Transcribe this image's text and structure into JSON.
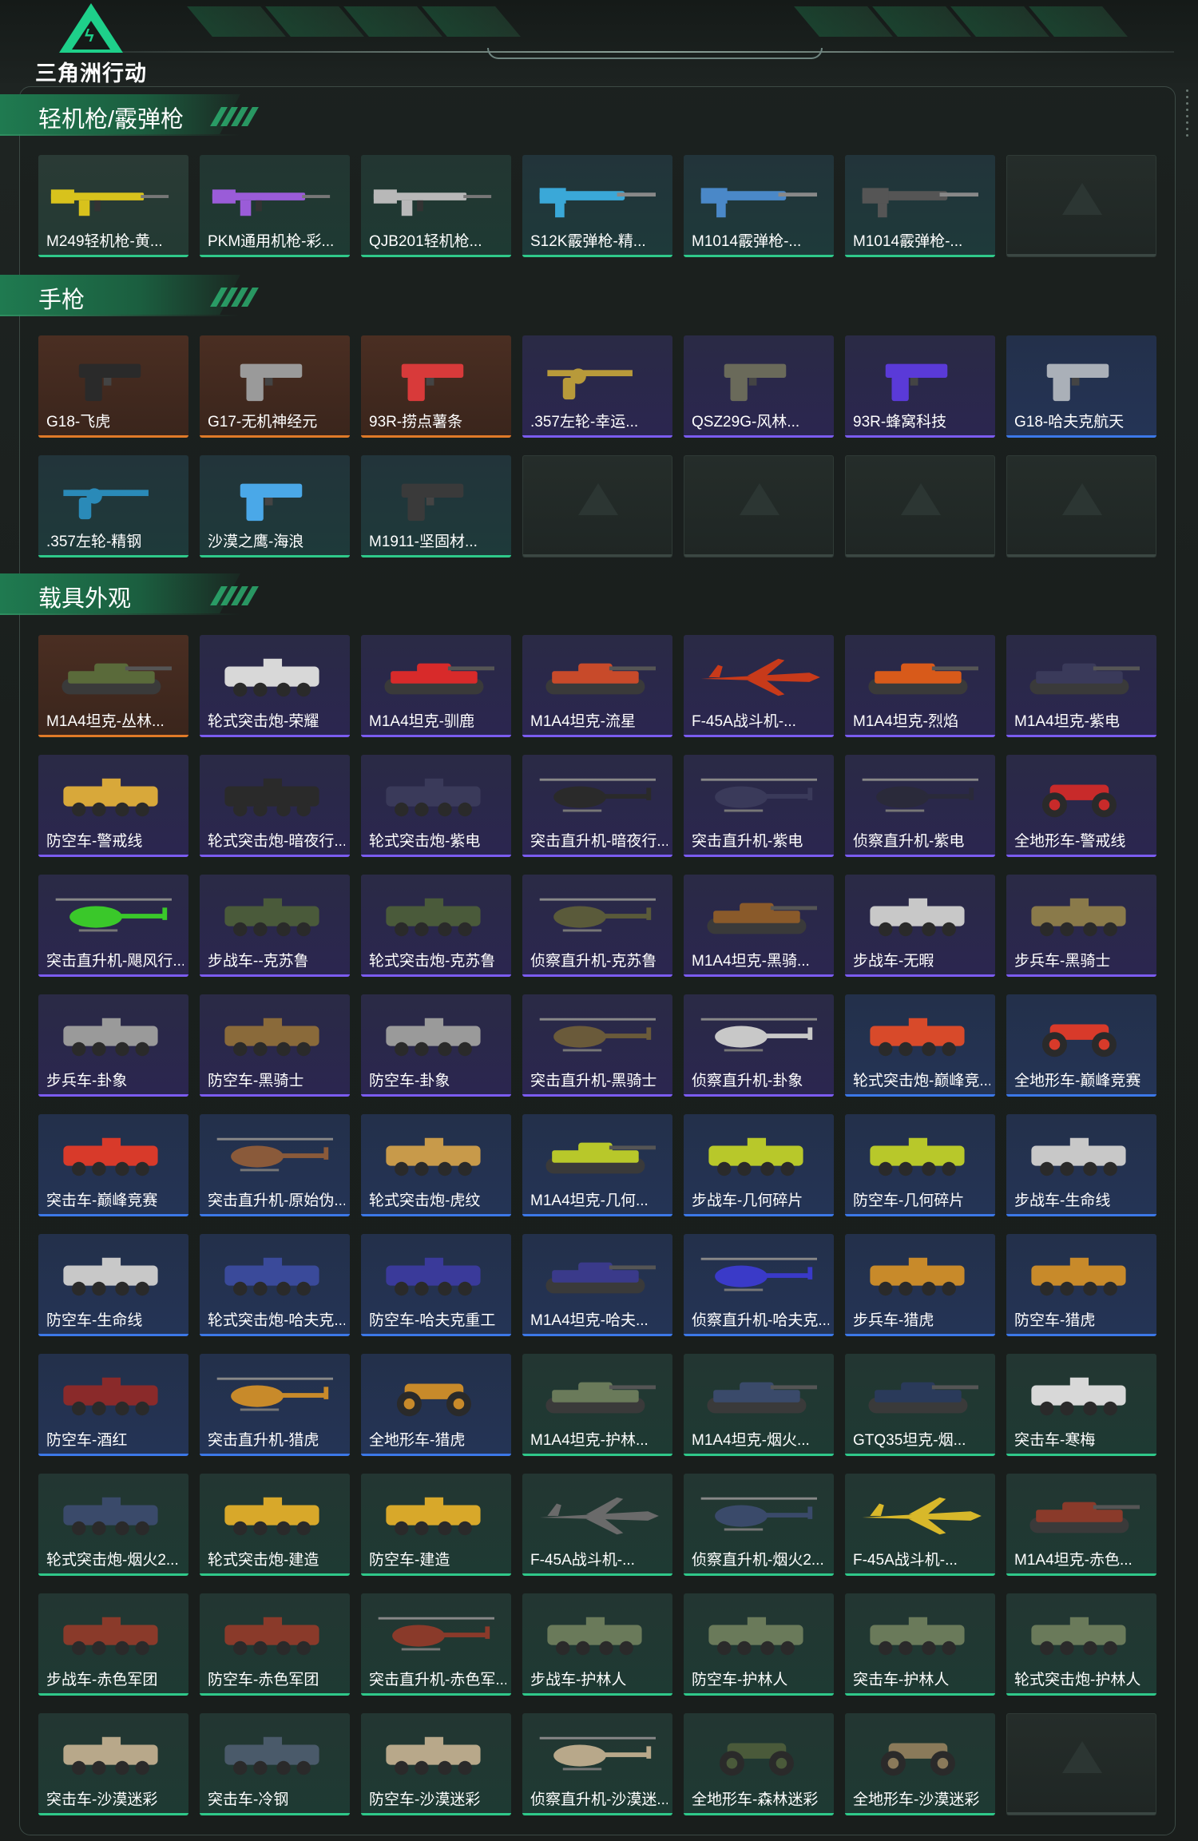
{
  "header": {
    "logo_text": "三角洲行动"
  },
  "sections": [
    {
      "title": "轻机枪/霰弹枪",
      "items": [
        {
          "name": "M249轻机枪-黄...",
          "quality": "gold",
          "icon": "lmg-icon",
          "color": "#d8c21c"
        },
        {
          "name": "PKM通用机枪-彩...",
          "quality": "green",
          "icon": "lmg-icon",
          "color": "#9a5cd8"
        },
        {
          "name": "QJB201轻机枪...",
          "quality": "green",
          "icon": "lmg-icon",
          "color": "#b8b8b8"
        },
        {
          "name": "S12K霰弹枪-精...",
          "quality": "teal",
          "icon": "shotgun-icon",
          "color": "#3aa8d8"
        },
        {
          "name": "M1014霰弹枪-...",
          "quality": "teal",
          "icon": "shotgun-icon",
          "color": "#4a88c8"
        },
        {
          "name": "M1014霰弹枪-...",
          "quality": "teal",
          "icon": "shotgun-icon",
          "color": "#555555"
        },
        {
          "name": "",
          "quality": "empty",
          "icon": "",
          "color": ""
        }
      ]
    },
    {
      "title": "手枪",
      "items": [
        {
          "name": "G18-飞虎",
          "quality": "red",
          "icon": "pistol-icon",
          "color": "#2a2a2a"
        },
        {
          "name": "G17-无机神经元",
          "quality": "red",
          "icon": "pistol-icon",
          "color": "#9a9a9a"
        },
        {
          "name": "93R-捞点薯条",
          "quality": "red",
          "icon": "pistol-icon",
          "color": "#d83a3a"
        },
        {
          "name": ".357左轮-幸运...",
          "quality": "purple",
          "icon": "revolver-icon",
          "color": "#b89a3a"
        },
        {
          "name": "QSZ29G-风林...",
          "quality": "purple",
          "icon": "pistol-icon",
          "color": "#6a6a5a"
        },
        {
          "name": "93R-蜂窝科技",
          "quality": "purple",
          "icon": "pistol-icon",
          "color": "#5a3ad8"
        },
        {
          "name": "G18-哈夫克航天",
          "quality": "blue",
          "icon": "pistol-icon",
          "color": "#aab0b8"
        },
        {
          "name": ".357左轮-精钢",
          "quality": "teal",
          "icon": "revolver-icon",
          "color": "#2a8ab8"
        },
        {
          "name": "沙漠之鹰-海浪",
          "quality": "teal",
          "icon": "pistol-icon",
          "color": "#4aa8e8"
        },
        {
          "name": "M1911-坚固材...",
          "quality": "teal",
          "icon": "pistol-icon",
          "color": "#3a3a3a"
        },
        {
          "name": "",
          "quality": "empty",
          "icon": "",
          "color": ""
        },
        {
          "name": "",
          "quality": "empty",
          "icon": "",
          "color": ""
        },
        {
          "name": "",
          "quality": "empty",
          "icon": "",
          "color": ""
        },
        {
          "name": "",
          "quality": "empty",
          "icon": "",
          "color": ""
        }
      ]
    },
    {
      "title": "载具外观",
      "items": [
        {
          "name": "M1A4坦克-丛林...",
          "quality": "red",
          "icon": "tank-icon",
          "color": "#5a6a3a"
        },
        {
          "name": "轮式突击炮-荣耀",
          "quality": "purple",
          "icon": "apc-icon",
          "color": "#d8d8d8"
        },
        {
          "name": "M1A4坦克-驯鹿",
          "quality": "purple",
          "icon": "tank-icon",
          "color": "#d82a2a"
        },
        {
          "name": "M1A4坦克-流星",
          "quality": "purple",
          "icon": "tank-icon",
          "color": "#c84a2a"
        },
        {
          "name": "F-45A战斗机-...",
          "quality": "purple",
          "icon": "jet-icon",
          "color": "#c83a1a"
        },
        {
          "name": "M1A4坦克-烈焰",
          "quality": "purple",
          "icon": "tank-icon",
          "color": "#d85a1a"
        },
        {
          "name": "M1A4坦克-紫电",
          "quality": "purple",
          "icon": "tank-icon",
          "color": "#3a3a5a"
        },
        {
          "name": "防空车-警戒线",
          "quality": "purple",
          "icon": "apc-icon",
          "color": "#d8a83a"
        },
        {
          "name": "轮式突击炮-暗夜行...",
          "quality": "purple",
          "icon": "apc-icon",
          "color": "#2a2a2a"
        },
        {
          "name": "轮式突击炮-紫电",
          "quality": "purple",
          "icon": "apc-icon",
          "color": "#3a3a5a"
        },
        {
          "name": "突击直升机-暗夜行...",
          "quality": "purple",
          "icon": "helicopter-icon",
          "color": "#2a2a2a"
        },
        {
          "name": "突击直升机-紫电",
          "quality": "purple",
          "icon": "helicopter-icon",
          "color": "#3a3a5a"
        },
        {
          "name": "侦察直升机-紫电",
          "quality": "purple",
          "icon": "helicopter-icon",
          "color": "#2a2a3a"
        },
        {
          "name": "全地形车-警戒线",
          "quality": "purple",
          "icon": "atv-icon",
          "color": "#c82a2a"
        },
        {
          "name": "突击直升机-飓风行...",
          "quality": "purple",
          "icon": "helicopter-icon",
          "color": "#3ac82a"
        },
        {
          "name": "步战车--克苏鲁",
          "quality": "purple",
          "icon": "apc-icon",
          "color": "#4a5a3a"
        },
        {
          "name": "轮式突击炮-克苏鲁",
          "quality": "purple",
          "icon": "apc-icon",
          "color": "#4a5a3a"
        },
        {
          "name": "侦察直升机-克苏鲁",
          "quality": "purple",
          "icon": "helicopter-icon",
          "color": "#5a5a3a"
        },
        {
          "name": "M1A4坦克-黑骑...",
          "quality": "purple",
          "icon": "tank-icon",
          "color": "#8a5a2a"
        },
        {
          "name": "步战车-无暇",
          "quality": "purple",
          "icon": "apc-icon",
          "color": "#c8c8c8"
        },
        {
          "name": "步兵车-黑骑士",
          "quality": "purple",
          "icon": "apc-icon",
          "color": "#8a7a4a"
        },
        {
          "name": "步兵车-卦象",
          "quality": "purple",
          "icon": "apc-icon",
          "color": "#9a9a9a"
        },
        {
          "name": "防空车-黑骑士",
          "quality": "purple",
          "icon": "apc-icon",
          "color": "#8a6a3a"
        },
        {
          "name": "防空车-卦象",
          "quality": "purple",
          "icon": "apc-icon",
          "color": "#9a9a9a"
        },
        {
          "name": "突击直升机-黑骑士",
          "quality": "purple",
          "icon": "helicopter-icon",
          "color": "#6a5a3a"
        },
        {
          "name": "侦察直升机-卦象",
          "quality": "purple",
          "icon": "helicopter-icon",
          "color": "#c8c8c8"
        },
        {
          "name": "轮式突击炮-巅峰竞...",
          "quality": "blue",
          "icon": "apc-icon",
          "color": "#d84a2a"
        },
        {
          "name": "全地形车-巅峰竞赛",
          "quality": "blue",
          "icon": "atv-icon",
          "color": "#d83a2a"
        },
        {
          "name": "突击车-巅峰竞赛",
          "quality": "blue",
          "icon": "apc-icon",
          "color": "#d83a2a"
        },
        {
          "name": "突击直升机-原始伪...",
          "quality": "blue",
          "icon": "helicopter-icon",
          "color": "#8a5a3a"
        },
        {
          "name": "轮式突击炮-虎纹",
          "quality": "blue",
          "icon": "apc-icon",
          "color": "#c89a4a"
        },
        {
          "name": "M1A4坦克-几何...",
          "quality": "blue",
          "icon": "tank-icon",
          "color": "#b8c82a"
        },
        {
          "name": "步战车-几何碎片",
          "quality": "blue",
          "icon": "apc-icon",
          "color": "#b8c82a"
        },
        {
          "name": "防空车-几何碎片",
          "quality": "blue",
          "icon": "apc-icon",
          "color": "#b8c82a"
        },
        {
          "name": "步战车-生命线",
          "quality": "blue",
          "icon": "apc-icon",
          "color": "#c8c8c8"
        },
        {
          "name": "防空车-生命线",
          "quality": "blue",
          "icon": "apc-icon",
          "color": "#c8c8c8"
        },
        {
          "name": "轮式突击炮-哈夫克...",
          "quality": "blue",
          "icon": "apc-icon",
          "color": "#3a4a9a"
        },
        {
          "name": "防空车-哈夫克重工",
          "quality": "blue",
          "icon": "apc-icon",
          "color": "#3a3a9a"
        },
        {
          "name": "M1A4坦克-哈夫...",
          "quality": "blue",
          "icon": "tank-icon",
          "color": "#3a3a8a"
        },
        {
          "name": "侦察直升机-哈夫克...",
          "quality": "blue",
          "icon": "helicopter-icon",
          "color": "#3a3ac8"
        },
        {
          "name": "步兵车-猎虎",
          "quality": "blue",
          "icon": "apc-icon",
          "color": "#c88a2a"
        },
        {
          "name": "防空车-猎虎",
          "quality": "blue",
          "icon": "apc-icon",
          "color": "#c88a2a"
        },
        {
          "name": "防空车-酒红",
          "quality": "blue",
          "icon": "apc-icon",
          "color": "#8a2a2a"
        },
        {
          "name": "突击直升机-猎虎",
          "quality": "blue",
          "icon": "helicopter-icon",
          "color": "#c88a2a"
        },
        {
          "name": "全地形车-猎虎",
          "quality": "blue",
          "icon": "atv-icon",
          "color": "#c88a2a"
        },
        {
          "name": "M1A4坦克-护林...",
          "quality": "green",
          "icon": "tank-icon",
          "color": "#6a7a5a"
        },
        {
          "name": "M1A4坦克-烟火...",
          "quality": "green",
          "icon": "tank-icon",
          "color": "#3a4a6a"
        },
        {
          "name": "GTQ35坦克-烟...",
          "quality": "green",
          "icon": "tank-icon",
          "color": "#2a3a5a"
        },
        {
          "name": "突击车-寒梅",
          "quality": "green",
          "icon": "apc-icon",
          "color": "#d8d8d8"
        },
        {
          "name": "轮式突击炮-烟火2...",
          "quality": "green",
          "icon": "apc-icon",
          "color": "#3a4a6a"
        },
        {
          "name": "轮式突击炮-建造",
          "quality": "green",
          "icon": "apc-icon",
          "color": "#d8a82a"
        },
        {
          "name": "防空车-建造",
          "quality": "green",
          "icon": "apc-icon",
          "color": "#d8a82a"
        },
        {
          "name": "F-45A战斗机-...",
          "quality": "green",
          "icon": "jet-icon",
          "color": "#6a6a6a"
        },
        {
          "name": "侦察直升机-烟火2...",
          "quality": "green",
          "icon": "helicopter-icon",
          "color": "#3a4a6a"
        },
        {
          "name": "F-45A战斗机-...",
          "quality": "green",
          "icon": "jet-icon",
          "color": "#d8b82a"
        },
        {
          "name": "M1A4坦克-赤色...",
          "quality": "green",
          "icon": "tank-icon",
          "color": "#8a3a2a"
        },
        {
          "name": "步战车-赤色军团",
          "quality": "green",
          "icon": "apc-icon",
          "color": "#8a3a2a"
        },
        {
          "name": "防空车-赤色军团",
          "quality": "green",
          "icon": "apc-icon",
          "color": "#8a3a2a"
        },
        {
          "name": "突击直升机-赤色军...",
          "quality": "green",
          "icon": "helicopter-icon",
          "color": "#8a3a2a"
        },
        {
          "name": "步战车-护林人",
          "quality": "green",
          "icon": "apc-icon",
          "color": "#6a7a5a"
        },
        {
          "name": "防空车-护林人",
          "quality": "green",
          "icon": "apc-icon",
          "color": "#6a7a5a"
        },
        {
          "name": "突击车-护林人",
          "quality": "green",
          "icon": "apc-icon",
          "color": "#6a7a5a"
        },
        {
          "name": "轮式突击炮-护林人",
          "quality": "green",
          "icon": "apc-icon",
          "color": "#6a7a5a"
        },
        {
          "name": "突击车-沙漠迷彩",
          "quality": "green",
          "icon": "apc-icon",
          "color": "#b8a88a"
        },
        {
          "name": "突击车-冷钢",
          "quality": "green",
          "icon": "apc-icon",
          "color": "#4a5a6a"
        },
        {
          "name": "防空车-沙漠迷彩",
          "quality": "green",
          "icon": "apc-icon",
          "color": "#b8a88a"
        },
        {
          "name": "侦察直升机-沙漠迷...",
          "quality": "green",
          "icon": "helicopter-icon",
          "color": "#b8a88a"
        },
        {
          "name": "全地形车-森林迷彩",
          "quality": "green",
          "icon": "atv-icon",
          "color": "#4a5a3a"
        },
        {
          "name": "全地形车-沙漠迷彩",
          "quality": "green",
          "icon": "atv-icon",
          "color": "#8a7a5a"
        },
        {
          "name": "",
          "quality": "empty",
          "icon": "",
          "color": ""
        }
      ]
    }
  ]
}
